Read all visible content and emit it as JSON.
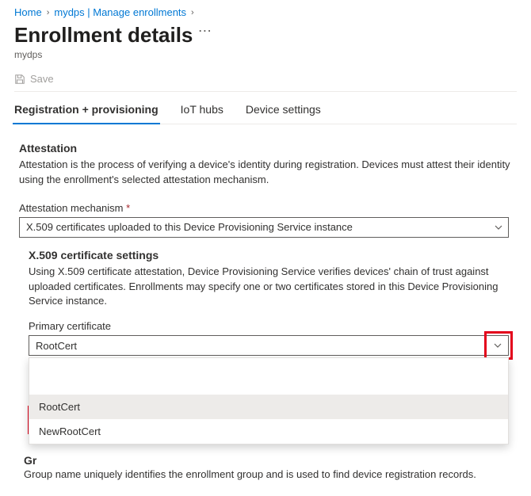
{
  "breadcrumb": {
    "home": "Home",
    "item1": "mydps | Manage enrollments"
  },
  "header": {
    "title": "Enrollment details",
    "subtitle": "mydps"
  },
  "toolbar": {
    "save_label": "Save"
  },
  "tabs": {
    "t0": "Registration + provisioning",
    "t1": "IoT hubs",
    "t2": "Device settings"
  },
  "attestation": {
    "heading": "Attestation",
    "desc": "Attestation is the process of verifying a device's identity during registration. Devices must attest their identity using the enrollment's selected attestation mechanism.",
    "mech_label": "Attestation mechanism",
    "mech_value": "X.509 certificates uploaded to this Device Provisioning Service instance"
  },
  "x509": {
    "heading": "X.509 certificate settings",
    "desc": "Using X.509 certificate attestation, Device Provisioning Service verifies devices' chain of trust against uploaded certificates. Enrollments may specify one or two certificates stored in this Device Provisioning Service instance.",
    "primary_label": "Primary certificate",
    "primary_value": "RootCert",
    "options": {
      "opt0": "RootCert",
      "opt1": "NewRootCert"
    }
  },
  "group": {
    "heading_partial": "Gr",
    "desc": "Group name uniquely identifies the enrollment group and is used to find device registration records."
  }
}
